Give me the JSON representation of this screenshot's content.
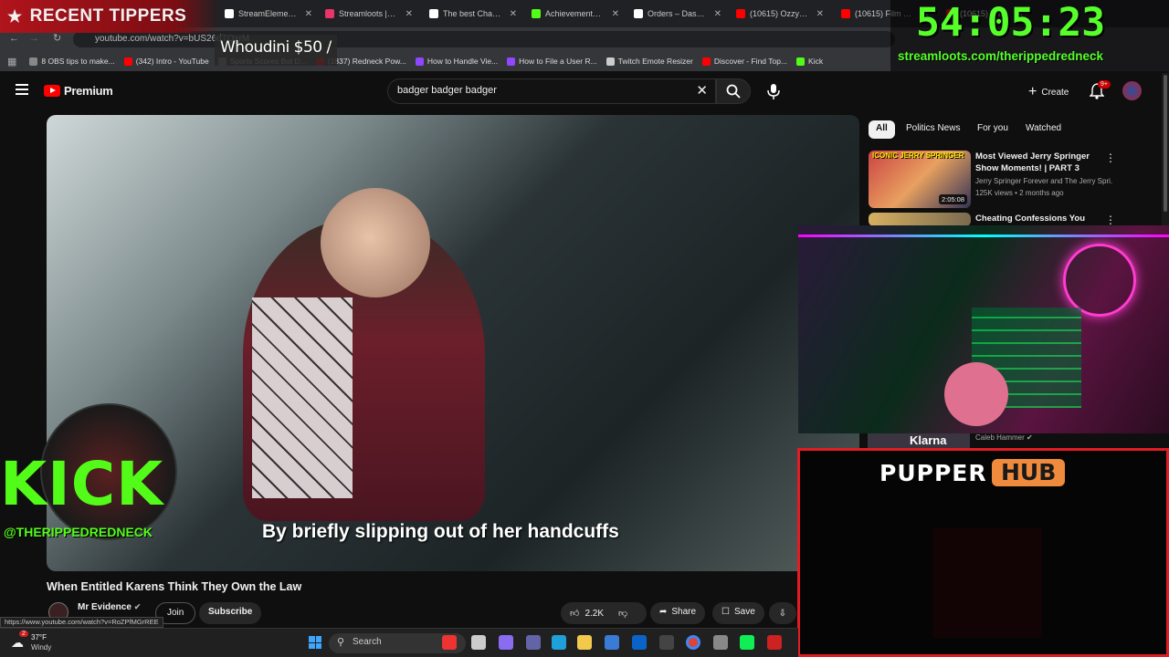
{
  "browser": {
    "tabs": [
      {
        "label": "StreamElements",
        "color": "#ffffff"
      },
      {
        "label": "Streamloots | Ther",
        "color": "#e8336b"
      },
      {
        "label": "The best ChatBot",
        "color": "#ffffff"
      },
      {
        "label": "Achievements - Ki",
        "color": "#53fc18"
      },
      {
        "label": "Orders – Dashboa",
        "color": "#ffffff"
      },
      {
        "label": "(10615) Ozzy Osb",
        "color": "#ff0000"
      },
      {
        "label": "(10615) Film Musi",
        "color": "#ff0000"
      },
      {
        "label": "(10615) Whe",
        "color": "#ff0000"
      }
    ],
    "url": "youtube.com/watch?v=bUS26dTQxrM",
    "bookmarks": [
      {
        "label": "8 OBS tips to make...",
        "color": "#888888"
      },
      {
        "label": "(342) Intro - YouTube",
        "color": "#ff0000"
      },
      {
        "label": "Sports Scores Bot D...",
        "color": "#888888"
      },
      {
        "label": "(1837) Redneck Pow...",
        "color": "#ff0000"
      },
      {
        "label": "How to Handle Vie...",
        "color": "#9146ff"
      },
      {
        "label": "How to File a User R...",
        "color": "#9146ff"
      },
      {
        "label": "Twitch Emote Resizer",
        "color": "#cccccc"
      },
      {
        "label": "Discover - Find Top...",
        "color": "#ff0000"
      },
      {
        "label": "Kick",
        "color": "#53fc18"
      }
    ],
    "status_url": "https://www.youtube.com/watch?v=RoZPfMGrREE"
  },
  "youtube": {
    "logo_text": "Premium",
    "search_value": "badger badger badger",
    "create_label": "Create",
    "notif_badge": "9+",
    "chips": [
      "All",
      "Politics News",
      "For you",
      "Watched"
    ],
    "video": {
      "caption": "By briefly slipping out of her handcuffs",
      "title": "When Entitled Karens Think They Own the Law",
      "channel": "Mr Evidence",
      "join_label": "Join",
      "subscribe_label": "Subscribe",
      "likes": "2.2K",
      "share_label": "Share",
      "save_label": "Save"
    },
    "sidebar": [
      {
        "title": "Most Viewed Jerry Springer Show Moments! | PART 3",
        "channel": "Jerry Springer Forever and The Jerry Spri...",
        "meta": "125K views • 2 months ago",
        "duration": "2:05:08",
        "thumb_text": "ICONIC JERRY SPRINGER"
      },
      {
        "title": "Cheating Confessions You",
        "channel": "Caleb Hammer",
        "meta": "",
        "duration": "",
        "thumb_text": "Klarna"
      }
    ]
  },
  "overlay": {
    "recent_tippers": "RECENT TIPPERS",
    "tipper": "Whoudini $50 /",
    "timer": "54:05:23",
    "streamloots_url": "streamloots.com/therippedredneck",
    "kick_logo": "KICK",
    "kick_handle": "@THERIPPEDREDNECK",
    "pupper_left": "PUPPER",
    "pupper_right": "HUB"
  },
  "taskbar": {
    "temp": "37°F",
    "weather": "Windy",
    "search_placeholder": "Search",
    "weather_badge": "2"
  }
}
